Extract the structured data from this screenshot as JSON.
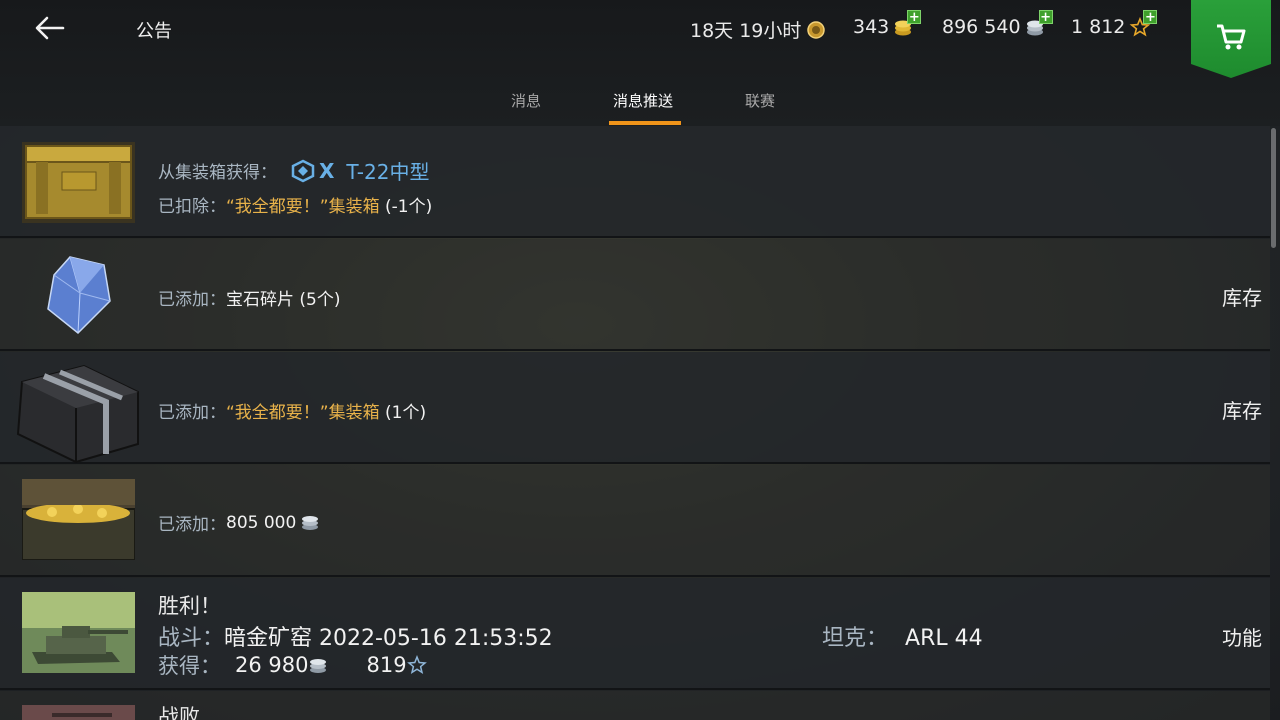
{
  "header": {
    "title": "公告",
    "premium_time": "18天 19小时",
    "gold": "343",
    "credits": "896 540",
    "free_xp": "1 812"
  },
  "tabs": [
    {
      "label": "消息"
    },
    {
      "label": "消息推送",
      "active": true
    },
    {
      "label": "联赛"
    }
  ],
  "messages": [
    {
      "line1_label": "从集装箱获得：",
      "line1_tier": "X",
      "line1_item": "T-22中型",
      "line2_label": "已扣除：",
      "line2_item": "“我全都要！”集装箱",
      "line2_count": "(-1个)"
    },
    {
      "label": "已添加：",
      "item": "宝石碎片",
      "count": "(5个)",
      "action": "库存"
    },
    {
      "label": "已添加：",
      "item": "“我全都要！”集装箱",
      "count": "(1个)",
      "action": "库存"
    },
    {
      "label": "已添加：",
      "value": "805 000"
    },
    {
      "title": "胜利！",
      "battle_label": "战斗：",
      "battle_value": "暗金矿窑 2022-05-16 21:53:52",
      "tank_label": "坦克：",
      "tank_value": "ARL 44",
      "earned_label": "获得：",
      "earned_credits": "26 980",
      "earned_xp": "819",
      "action": "功能"
    },
    {
      "title": "战败"
    }
  ],
  "colors": {
    "accent_orange": "#f0941a",
    "item_gold": "#e8b24a",
    "label_gray_blue": "#a9b6c2",
    "tier_blue": "#69b0e6",
    "shop_green": "#2aa03a"
  },
  "icons": [
    "back-arrow-icon",
    "premium-timer-icon",
    "gold-coins-icon",
    "silver-credits-icon",
    "free-xp-star-icon",
    "shopping-cart-icon"
  ]
}
